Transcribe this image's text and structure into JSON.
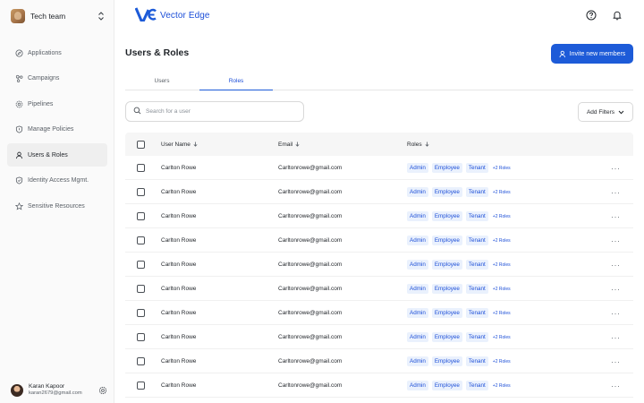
{
  "team": {
    "name": "Tech team"
  },
  "sidebar": {
    "items": [
      {
        "label": "Applications",
        "icon": "compass-icon",
        "active": false
      },
      {
        "label": "Campaigns",
        "icon": "share-nodes-icon",
        "active": false
      },
      {
        "label": "Pipelines",
        "icon": "gear-badge-icon",
        "active": false
      },
      {
        "label": "Manage Policies",
        "icon": "shield-icon",
        "active": false
      },
      {
        "label": "Users & Roles",
        "icon": "user-icon",
        "active": true
      },
      {
        "label": "Identity Access Mgmt.",
        "icon": "shield-check-icon",
        "active": false
      },
      {
        "label": "Sensitive Resources",
        "icon": "star-icon",
        "active": false
      }
    ]
  },
  "user": {
    "name": "Karan Kapoor",
    "email": "karan2679@gmail.com"
  },
  "brand": {
    "name": "Vector Edge",
    "accent": "#1d5bd8"
  },
  "page": {
    "title": "Users & Roles",
    "invite_label": "Invite new members",
    "tabs": [
      {
        "label": "Users",
        "active": false
      },
      {
        "label": "Roles",
        "active": true
      }
    ],
    "search_placeholder": "Search for a user",
    "filters_label": "Add Filters"
  },
  "table": {
    "columns": {
      "name": "User Name",
      "email": "Email",
      "roles": "Roles"
    },
    "rows": [
      {
        "name": "Carlton Rowe",
        "email": "Carltonrowe@gmail.com",
        "roles": [
          "Admin",
          "Employee",
          "Tenant"
        ],
        "more": "+2 Roles"
      },
      {
        "name": "Carlton Rowe",
        "email": "Carltonrowe@gmail.com",
        "roles": [
          "Admin",
          "Employee",
          "Tenant"
        ],
        "more": "+2 Roles"
      },
      {
        "name": "Carlton Rowe",
        "email": "Carltonrowe@gmail.com",
        "roles": [
          "Admin",
          "Employee",
          "Tenant"
        ],
        "more": "+2 Roles"
      },
      {
        "name": "Carlton Rowe",
        "email": "Carltonrowe@gmail.com",
        "roles": [
          "Admin",
          "Employee",
          "Tenant"
        ],
        "more": "+2 Roles"
      },
      {
        "name": "Carlton Rowe",
        "email": "Carltonrowe@gmail.com",
        "roles": [
          "Admin",
          "Employee",
          "Tenant"
        ],
        "more": "+2 Roles"
      },
      {
        "name": "Carlton Rowe",
        "email": "Carltonrowe@gmail.com",
        "roles": [
          "Admin",
          "Employee",
          "Tenant"
        ],
        "more": "+2 Roles"
      },
      {
        "name": "Carlton Rowe",
        "email": "Carltonrowe@gmail.com",
        "roles": [
          "Admin",
          "Employee",
          "Tenant"
        ],
        "more": "+2 Roles"
      },
      {
        "name": "Carlton Rowe",
        "email": "Carltonrowe@gmail.com",
        "roles": [
          "Admin",
          "Employee",
          "Tenant"
        ],
        "more": "+2 Roles"
      },
      {
        "name": "Carlton Rowe",
        "email": "Carltonrowe@gmail.com",
        "roles": [
          "Admin",
          "Employee",
          "Tenant"
        ],
        "more": "+2 Roles"
      },
      {
        "name": "Carlton Rowe",
        "email": "Carltonrowe@gmail.com",
        "roles": [
          "Admin",
          "Employee",
          "Tenant"
        ],
        "more": "+2 Roles"
      }
    ]
  }
}
